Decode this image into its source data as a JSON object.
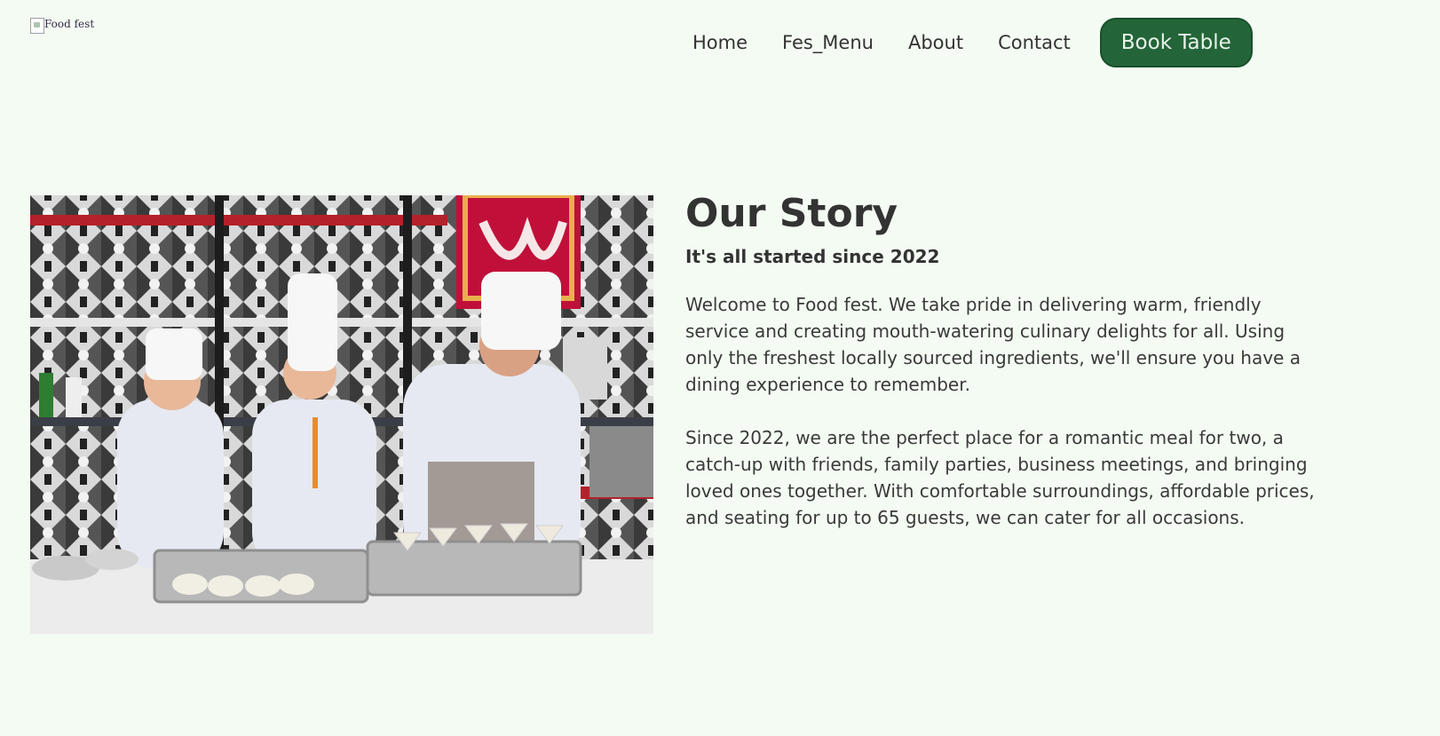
{
  "header": {
    "logo_alt": "Food fest",
    "nav": [
      {
        "label": "Home"
      },
      {
        "label": "Fes_Menu"
      },
      {
        "label": "About"
      },
      {
        "label": "Contact"
      }
    ],
    "cta_label": "Book Table",
    "cta_color": "#236538"
  },
  "story": {
    "title": "Our Story",
    "subtitle": "It's all started since 2022",
    "paragraphs": [
      "Welcome to Food fest. We take pride in delivering warm, friendly service and creating mouth-watering culinary delights for all. Using only the freshest locally sourced ingredients, we'll ensure you have a dining experience to remember.",
      "Since 2022, we are the perfect place for a romantic meal for two, a catch-up with friends, family parties, business meetings, and bringing loved ones together. With comfortable surroundings, affordable prices, and seating for up to 65 guests, we can cater for all occasions."
    ],
    "image_icon": "chefs-photo"
  },
  "colors": {
    "background": "#f3fbf2",
    "text": "#333333",
    "accent": "#236538"
  }
}
